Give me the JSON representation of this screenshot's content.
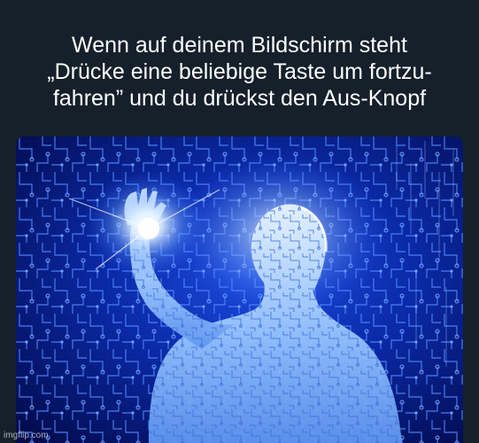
{
  "meme": {
    "caption_lines": [
      "Wenn auf deinem Bildschirm steht",
      "„Drücke eine beliebige Taste um fortzu-",
      "fahren” und du drückst den Aus-Knopf"
    ],
    "image_subject": "glowing-circuit-human-figure",
    "watermark": "imgflip.com"
  },
  "colors": {
    "background": "#15202b",
    "caption_text": "#ffffff",
    "image_dark_blue": "#020a4a",
    "image_glow_blue": "#3f7dff",
    "figure_light": "#cfe6ff"
  }
}
